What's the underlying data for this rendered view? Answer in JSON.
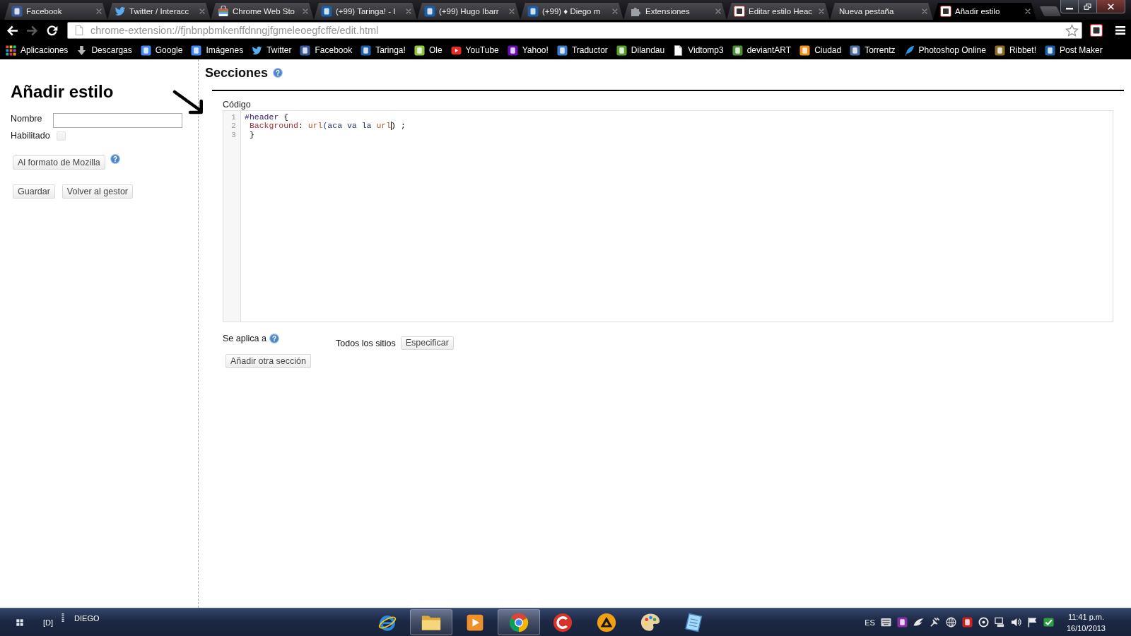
{
  "browser": {
    "tabs": [
      {
        "title": "Facebook",
        "selected": false
      },
      {
        "title": "Twitter / Interacc",
        "selected": false
      },
      {
        "title": "Chrome Web Sto",
        "selected": false
      },
      {
        "title": "(+99) Taringa! - I",
        "selected": false
      },
      {
        "title": "(+99) Hugo Ibarr",
        "selected": false
      },
      {
        "title": "(+99) ♦ Diego m",
        "selected": false
      },
      {
        "title": "Extensiones",
        "selected": false
      },
      {
        "title": "Editar estilo Heac",
        "selected": false
      },
      {
        "title": "Nueva pestaña",
        "selected": false
      },
      {
        "title": "Añadir estilo",
        "selected": true
      }
    ],
    "toolbar": {
      "forward_button": {
        "disabled": true
      },
      "address": "chrome-extension://fjnbnpbmkenffdnngjfgmeleoegfcffe/edit.html"
    },
    "bookmarks": [
      {
        "label": "Aplicaciones"
      },
      {
        "label": "Descargas"
      },
      {
        "label": "Google"
      },
      {
        "label": "Imágenes"
      },
      {
        "label": "Twitter"
      },
      {
        "label": "Facebook"
      },
      {
        "label": "Taringa!"
      },
      {
        "label": "Ole"
      },
      {
        "label": "YouTube"
      },
      {
        "label": "Yahoo!"
      },
      {
        "label": "Traductor"
      },
      {
        "label": "Dilandau"
      },
      {
        "label": "Vidtomp3"
      },
      {
        "label": "deviantART"
      },
      {
        "label": "Ciudad"
      },
      {
        "label": "Torrentz"
      },
      {
        "label": "Photoshop Online"
      },
      {
        "label": "Ribbet!"
      },
      {
        "label": "Post Maker"
      }
    ]
  },
  "sidebar": {
    "title": "Añadir estilo",
    "name_field": {
      "label": "Nombre"
    },
    "enabled": {
      "label": "Habilitado",
      "checked": false
    },
    "mozilla_button": "Al formato de Mozilla",
    "buttons": [
      "Guardar",
      "Volver al gestor"
    ]
  },
  "sections": {
    "title": "Secciones",
    "code_label": "Código",
    "editor": {
      "lines": [
        {
          "number": "1",
          "tokens": [
            {
              "kind": "selector",
              "text": "#header"
            },
            {
              "kind": "plain",
              "text": " {"
            }
          ]
        },
        {
          "number": "2",
          "tokens": [
            {
              "kind": "property",
              "text": " Background"
            },
            {
              "kind": "plain",
              "text": ": "
            },
            {
              "kind": "function",
              "text": "url"
            },
            {
              "kind": "variable",
              "text": "(aca va la "
            },
            {
              "kind": "function",
              "text": "url",
              "cursor_after": true
            },
            {
              "kind": "plain",
              "text": ") ;"
            }
          ]
        },
        {
          "number": "3",
          "tokens": [
            {
              "kind": "plain",
              "text": " }"
            }
          ]
        }
      ]
    },
    "applies_to": {
      "label": "Se aplica a",
      "value": "Todos los sitios",
      "button": "Especificar"
    },
    "add_button": "Añadir otra sección"
  },
  "taskbar": {
    "drive_label": "[D]",
    "user_label": "DIEGO",
    "apps": [
      {
        "running": false
      },
      {
        "running": true
      },
      {
        "running": false
      },
      {
        "running": true
      },
      {
        "running": false
      },
      {
        "running": false
      },
      {
        "running": false
      },
      {
        "running": false
      }
    ],
    "language": "ES",
    "time": "11:41 p.m.",
    "date": "16/10/2013"
  }
}
